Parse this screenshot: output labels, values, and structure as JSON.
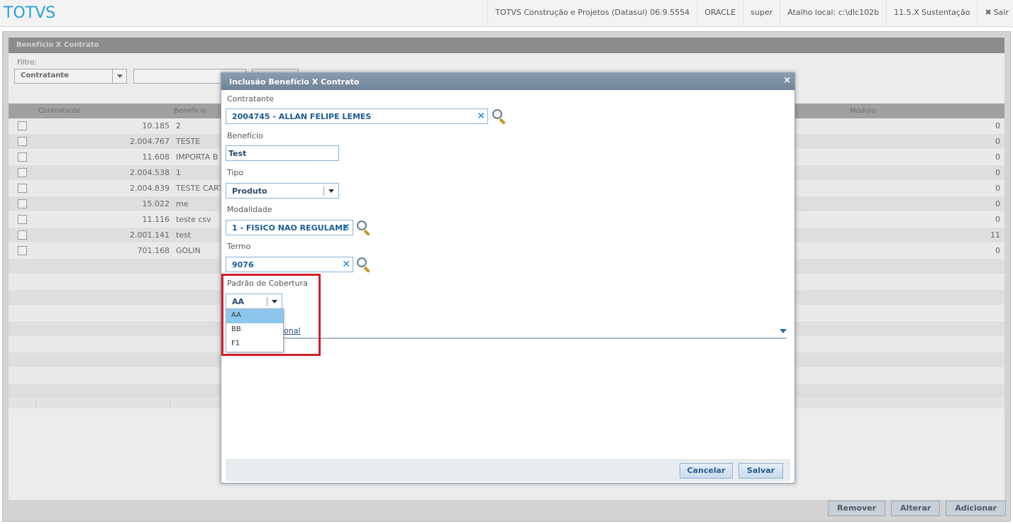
{
  "topbar": {
    "brand": "TOTVS",
    "product": "TOTVS Construção e Projetos (Datasul) 06.9.5554",
    "database": "ORACLE",
    "user": "super",
    "shortcut": "Atalho local: c:\\dlc102b",
    "version": "11.5.X Sustentação",
    "exit_label": "Sair"
  },
  "background": {
    "panel_title": "Benefício X Contrato",
    "filter_label": "Filtro:",
    "filter_value": "Contratante",
    "columns": [
      "Contratante",
      "Benefício",
      "Módulo"
    ],
    "rows": [
      {
        "contratante": "10.185",
        "beneficio": "2",
        "modulo": "0"
      },
      {
        "contratante": "2.004.767",
        "beneficio": "TESTE",
        "modulo": "0"
      },
      {
        "contratante": "11.608",
        "beneficio": "IMPORTA B",
        "modulo": "0"
      },
      {
        "contratante": "2.004.538",
        "beneficio": "1",
        "modulo": "0"
      },
      {
        "contratante": "2.004.839",
        "beneficio": "TESTE CART",
        "modulo": "0"
      },
      {
        "contratante": "15.022",
        "beneficio": "me",
        "modulo": "0"
      },
      {
        "contratante": "11.116",
        "beneficio": "teste csv",
        "modulo": "0"
      },
      {
        "contratante": "2.001.141",
        "beneficio": "test",
        "modulo": "11"
      },
      {
        "contratante": "701.168",
        "beneficio": "GOLIN",
        "modulo": "0"
      }
    ],
    "buttons": {
      "remover": "Remover",
      "alterar": "Alterar",
      "adicionar": "Adicionar"
    }
  },
  "modal": {
    "title": "Inclusão Benefício X Contrato",
    "close": "×",
    "contratante_label": "Contratante",
    "contratante_value": "2004745 - ALLAN FELIPE LEMES",
    "beneficio_label": "Benefício",
    "beneficio_value": "Test",
    "tipo_label": "Tipo",
    "tipo_value": "Produto",
    "modalidade_label": "Modalidade",
    "modalidade_value": "1 - FISICO NAO REGULAME",
    "termo_label": "Termo",
    "termo_value": "9076",
    "padrao_label": "Padrão de Cobertura",
    "padrao_value": "AA",
    "padrao_options": [
      "AA",
      "BB",
      "F1"
    ],
    "opcional_link": "onal",
    "cancelar": "Cancelar",
    "salvar": "Salvar"
  },
  "colors": {
    "brand": "#2a9fd6",
    "highlight": "#d0202a",
    "selected_option": "#8cc8ee",
    "clear_icon": "#1a82d0"
  }
}
